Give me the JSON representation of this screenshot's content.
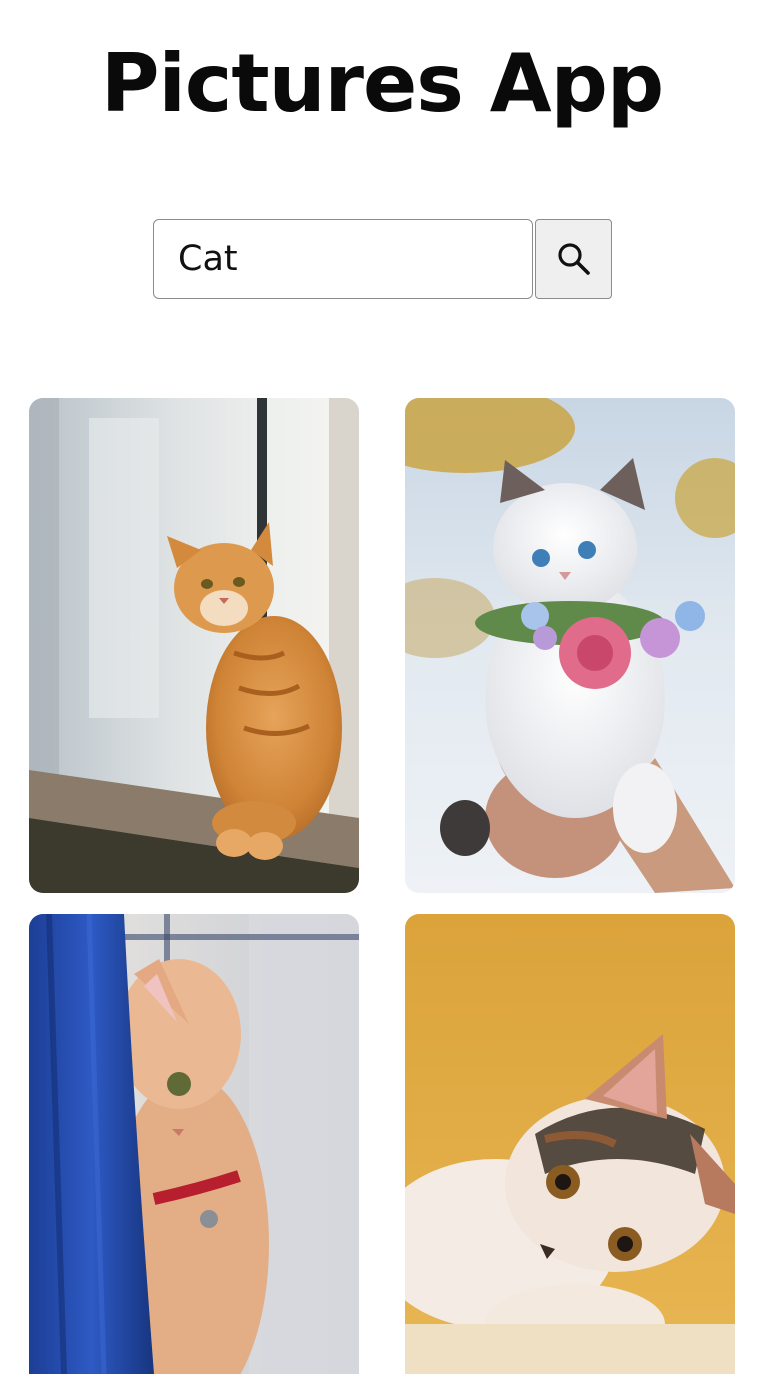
{
  "header": {
    "title": "Pictures App"
  },
  "search": {
    "value": "Cat",
    "button_icon": "search-icon"
  },
  "gallery": {
    "photos": [
      {
        "subject": "orange-tabby-cat-on-windowsill"
      },
      {
        "subject": "white-kitten-with-flower-collar-held-in-hands"
      },
      {
        "subject": "cat-peeking-behind-blue-curtain"
      },
      {
        "subject": "calico-kitten-lying-on-yellow-background"
      }
    ]
  },
  "colors": {
    "background": "#ffffff",
    "title": "#0a0a0a",
    "input_border": "#8c8c8c",
    "button_background": "#efefef"
  }
}
